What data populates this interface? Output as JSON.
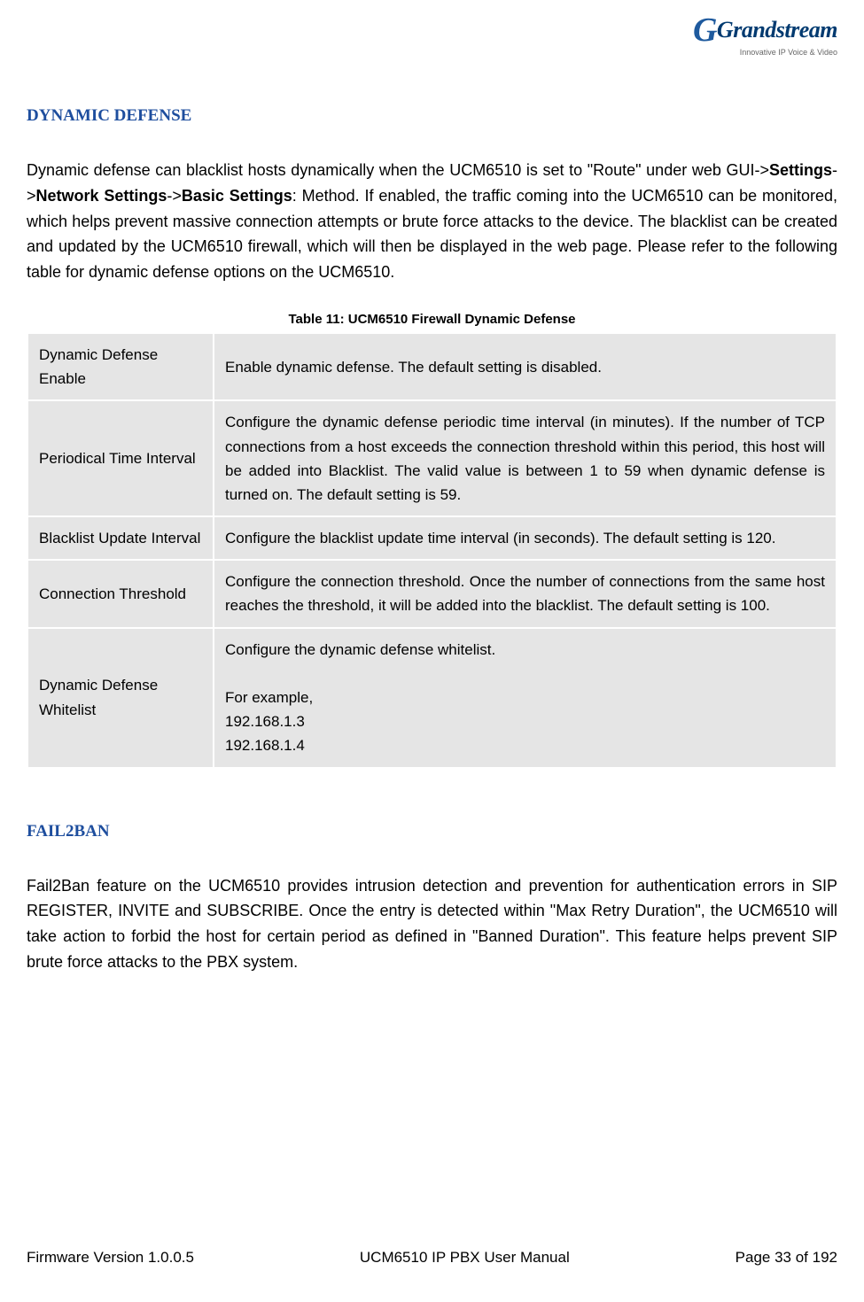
{
  "logo_brand": "Grandstream",
  "logo_tagline": "Innovative IP Voice & Video",
  "section1_heading": "DYNAMIC DEFENSE",
  "para1_pre": "Dynamic defense can blacklist hosts dynamically when the UCM6510 is set to \"Route\" under web GUI->",
  "para1_b1": "Settings",
  "para1_mid1": "->",
  "para1_b2": "Network Settings",
  "para1_mid2": "->",
  "para1_b3": "Basic Settings",
  "para1_post": ": Method. If enabled, the traffic coming into the UCM6510 can be monitored, which helps prevent massive connection attempts or brute force attacks to the device. The blacklist can be created and updated by the UCM6510 firewall, which will then be displayed in the web page. Please refer to the following table for dynamic defense options on the UCM6510.",
  "table_caption": "Table 11: UCM6510 Firewall Dynamic Defense",
  "rows": [
    {
      "name": "Dynamic Defense Enable",
      "desc": "Enable dynamic defense. The default setting is disabled."
    },
    {
      "name": "Periodical Time Interval",
      "desc": "Configure the dynamic defense periodic time interval (in minutes). If the number of TCP connections from a host exceeds the connection threshold within this period, this host will be added into Blacklist. The valid value is between 1 to 59 when dynamic defense is turned on. The default setting is 59."
    },
    {
      "name": "Blacklist Update Interval",
      "desc": "Configure the blacklist update time interval (in seconds). The default setting is 120."
    },
    {
      "name": "Connection Threshold",
      "desc": "Configure the connection threshold. Once the number of connections from the same host reaches the threshold, it will be added into the blacklist. The default setting is 100."
    },
    {
      "name": "Dynamic Defense Whitelist",
      "desc": ""
    }
  ],
  "whitelist_line1": "Configure the dynamic defense whitelist.",
  "whitelist_line_blank": " ",
  "whitelist_line2": "For example,",
  "whitelist_line3": "192.168.1.3",
  "whitelist_line4": "192.168.1.4",
  "section2_heading": "FAIL2BAN",
  "para2": "Fail2Ban feature on the UCM6510 provides intrusion detection and prevention for authentication errors in SIP REGISTER, INVITE and SUBSCRIBE. Once the entry is detected within \"Max Retry Duration\", the UCM6510 will take action to forbid the host for certain period as defined in \"Banned Duration\". This feature helps prevent SIP brute force attacks to the PBX system.",
  "footer_left": "Firmware Version 1.0.0.5",
  "footer_center": "UCM6510 IP PBX User Manual",
  "footer_right": "Page 33 of 192"
}
